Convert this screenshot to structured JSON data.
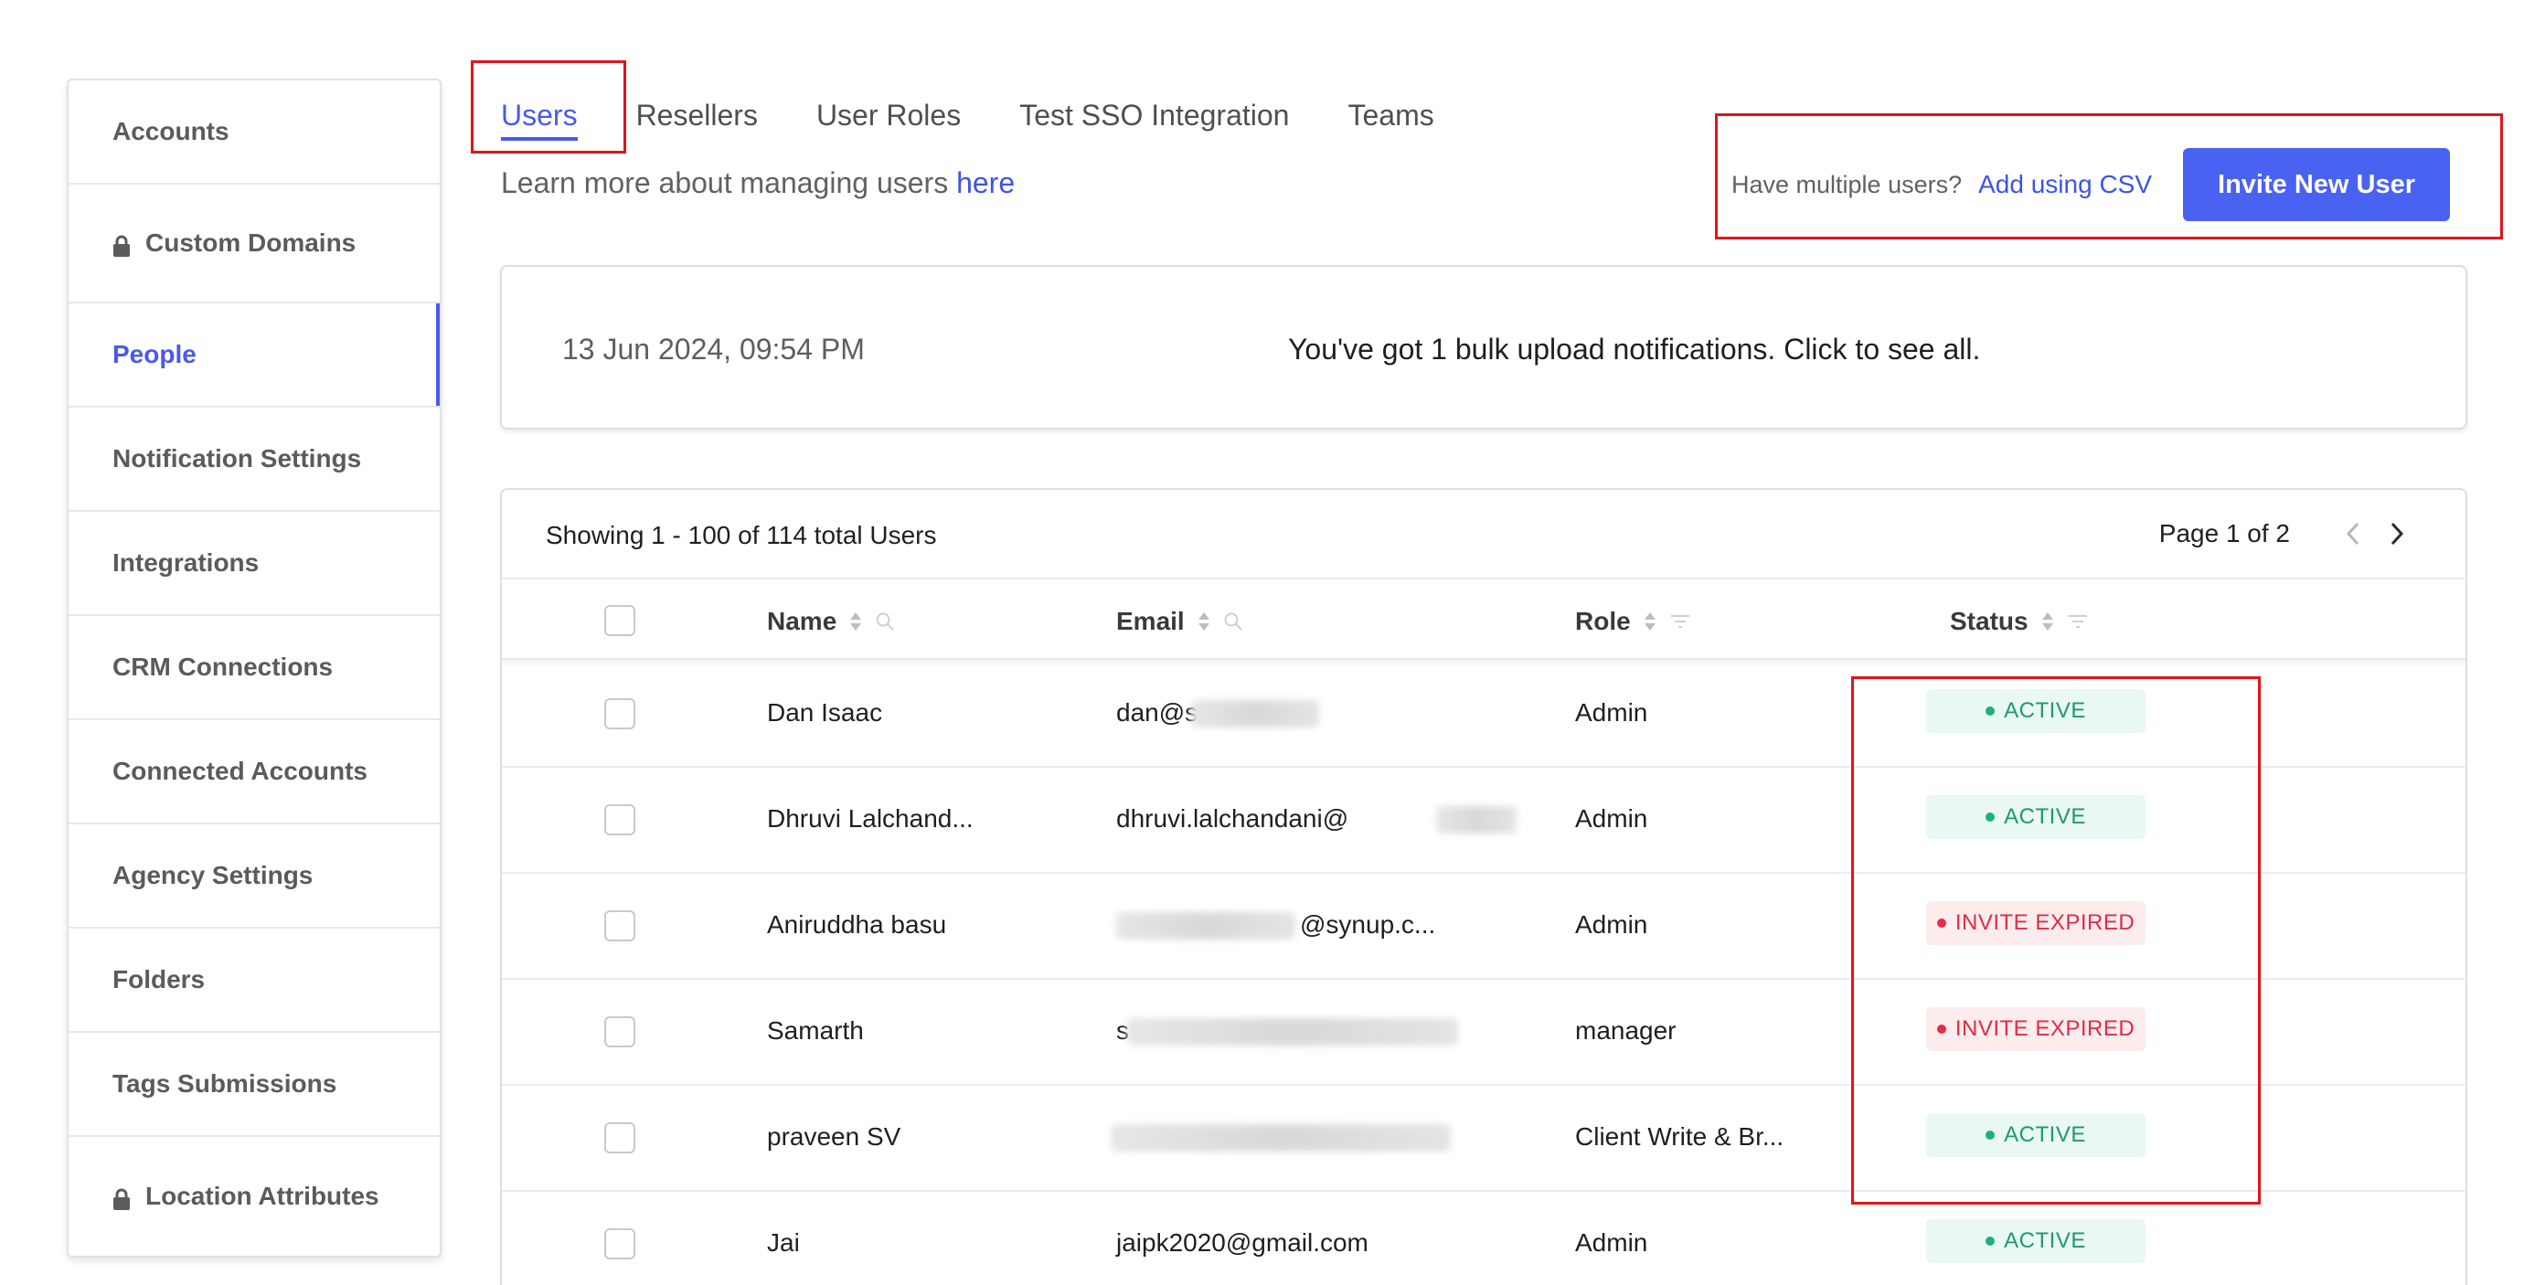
{
  "sidebar": {
    "items": [
      {
        "label": "Accounts",
        "icon": "",
        "active": false
      },
      {
        "label": "Custom Domains",
        "icon": "lock-icon",
        "active": false
      },
      {
        "label": "People",
        "icon": "",
        "active": true
      },
      {
        "label": "Notification Settings",
        "icon": "",
        "active": false
      },
      {
        "label": "Integrations",
        "icon": "",
        "active": false
      },
      {
        "label": "CRM Connections",
        "icon": "",
        "active": false
      },
      {
        "label": "Connected Accounts",
        "icon": "",
        "active": false
      },
      {
        "label": "Agency Settings",
        "icon": "",
        "active": false
      },
      {
        "label": "Folders",
        "icon": "",
        "active": false
      },
      {
        "label": "Tags Submissions",
        "icon": "",
        "active": false
      },
      {
        "label": "Location Attributes",
        "icon": "lock-icon",
        "active": false
      }
    ]
  },
  "tabs": [
    {
      "label": "Users",
      "active": true
    },
    {
      "label": "Resellers",
      "active": false
    },
    {
      "label": "User Roles",
      "active": false
    },
    {
      "label": "Test SSO Integration",
      "active": false
    },
    {
      "label": "Teams",
      "active": false
    }
  ],
  "learn": {
    "text": "Learn more about managing users ",
    "link": "here"
  },
  "csv": {
    "question": "Have multiple users?",
    "link": "Add using CSV",
    "invite_label": "Invite New User"
  },
  "notification": {
    "date": "13 Jun 2024, 09:54 PM",
    "message": "You've got 1 bulk upload notifications. Click to see all."
  },
  "table": {
    "showing": "Showing 1 - 100 of 114 total Users",
    "page": "Page 1 of 2",
    "columns": {
      "name": "Name",
      "email": "Email",
      "role": "Role",
      "status": "Status"
    },
    "rows": [
      {
        "name": "Dan Isaac",
        "email": "dan@s",
        "role": "Admin",
        "status": "ACTIVE",
        "status_type": "active"
      },
      {
        "name": "Dhruvi Lalchand...",
        "email": "dhruvi.lalchandani@",
        "role": "Admin",
        "status": "ACTIVE",
        "status_type": "active"
      },
      {
        "name": "Aniruddha basu",
        "email": "@synup.c...",
        "role": "Admin",
        "status": "INVITE EXPIRED",
        "status_type": "expired"
      },
      {
        "name": "Samarth",
        "email": "s",
        "role": "manager",
        "status": "INVITE EXPIRED",
        "status_type": "expired"
      },
      {
        "name": "praveen SV",
        "email": "",
        "role": "Client Write & Br...",
        "status": "ACTIVE",
        "status_type": "active"
      },
      {
        "name": "Jai",
        "email": "jaipk2020@gmail.com",
        "role": "Admin",
        "status": "ACTIVE",
        "status_type": "active"
      }
    ]
  },
  "colors": {
    "accent": "#4a5ae8",
    "button": "#4a62f2",
    "highlight": "#e1141b",
    "active_text": "#1c9a6b",
    "expired_text": "#e02b45"
  }
}
